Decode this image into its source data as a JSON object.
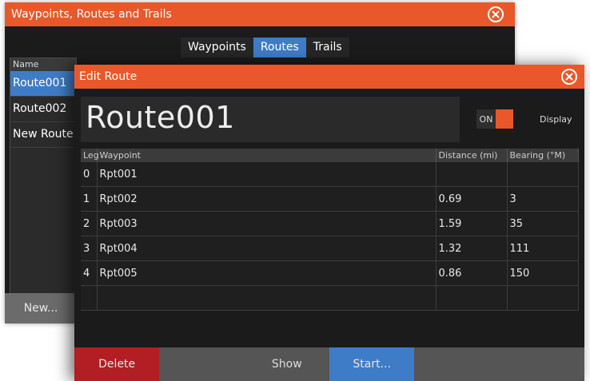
{
  "wrt": {
    "title": "Waypoints, Routes and Trails",
    "tabs": [
      "Waypoints",
      "Routes",
      "Trails"
    ],
    "active_tab": "Routes",
    "list_header": "Name",
    "routes": [
      "Route001",
      "Route002",
      "New Route..."
    ],
    "new_button": "New..."
  },
  "edit": {
    "title": "Edit Route",
    "route_name": "Route001",
    "toggle_label": "ON",
    "display_label": "Display",
    "columns": [
      "Leg",
      "Waypoint",
      "Distance (mi)",
      "Bearing (°M)"
    ],
    "rows": [
      [
        "0",
        "Rpt001",
        "",
        ""
      ],
      [
        "1",
        "Rpt002",
        "0.69",
        "3"
      ],
      [
        "2",
        "Rpt003",
        "1.59",
        "35"
      ],
      [
        "3",
        "Rpt004",
        "1.32",
        "111"
      ],
      [
        "4",
        "Rpt005",
        "0.86",
        "150"
      ],
      [
        "",
        "",
        "",
        ""
      ]
    ],
    "actions": {
      "delete": "Delete",
      "show": "Show",
      "start": "Start..."
    }
  },
  "colors": {
    "accent": "#e8582a",
    "selection": "#3f7cc7",
    "delete": "#b11e23"
  }
}
